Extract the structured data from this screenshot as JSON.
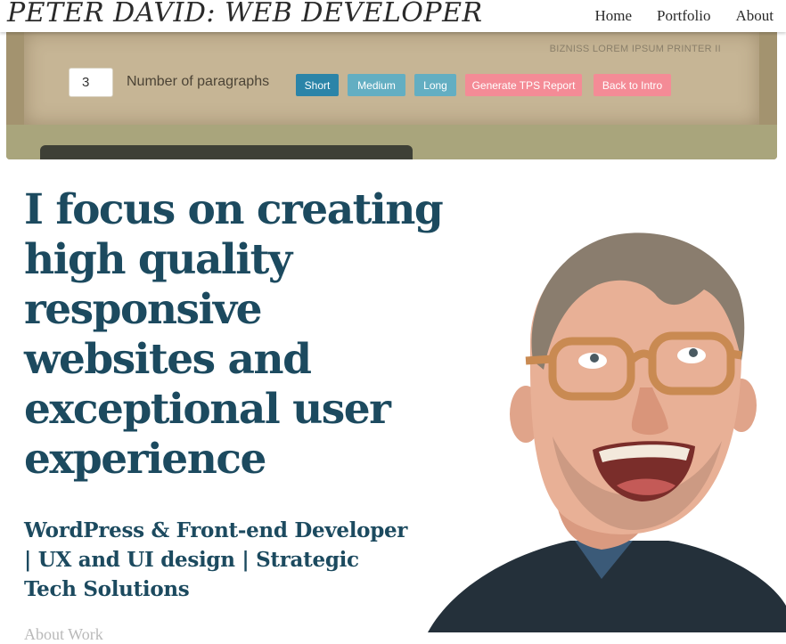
{
  "navbar": {
    "brand": "PETER DAVID: WEB DEVELOPER",
    "links": [
      "Home",
      "Portfolio",
      "About"
    ]
  },
  "generator": {
    "tagline": "BIZNISS LOREM IPSUM PRINTER II",
    "paragraph_count": "3",
    "paragraph_label": "Number of paragraphs",
    "buttons": {
      "short": "Short",
      "medium": "Medium",
      "long": "Long",
      "tps": "Generate TPS Report",
      "back": "Back to Intro"
    }
  },
  "hero": {
    "title": "I focus on creating high quality responsive websites and exceptional user experience",
    "subtitle": "WordPress & Front-end Developer | UX and UI design | Strategic Tech Solutions",
    "cut_text": "About Work"
  },
  "colors": {
    "heading": "#1c4a5f",
    "short_button": "#2b84a8",
    "size_button": "#63aec2",
    "pink_button": "#f48b96",
    "panel": "#c6b595"
  }
}
